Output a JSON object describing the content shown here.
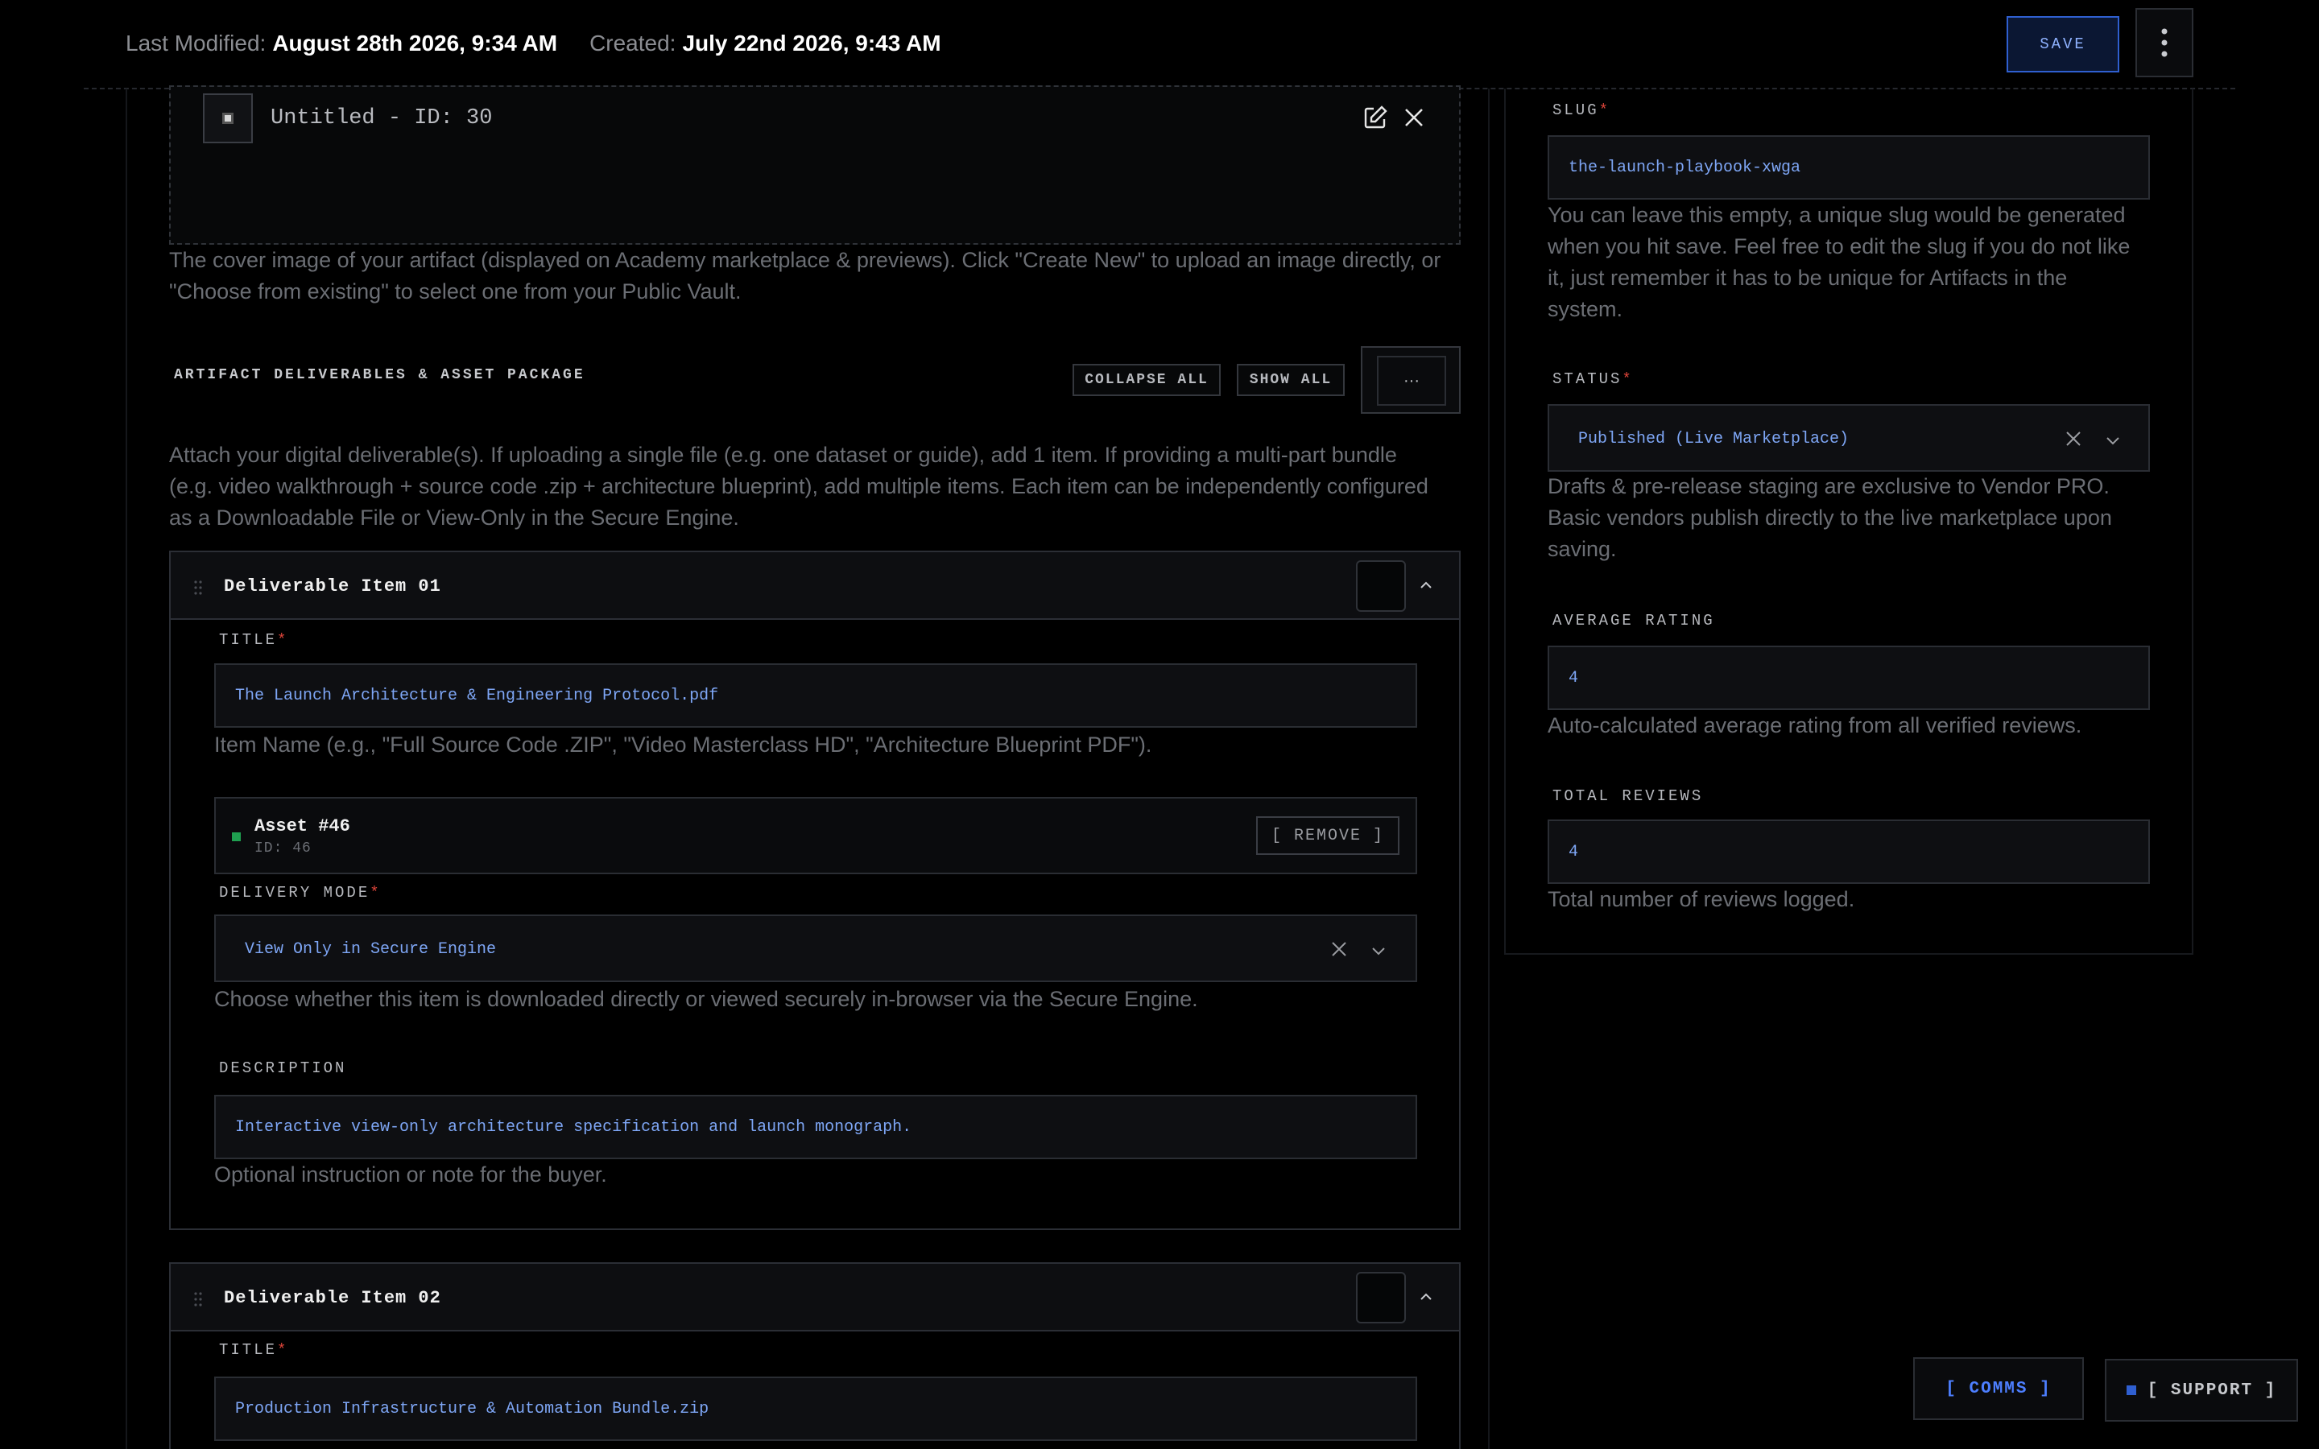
{
  "header": {
    "last_modified_label": "Last Modified:",
    "last_modified_value": "August 28th 2026, 9:34 AM",
    "created_label": "Created:",
    "created_value": "July 22nd 2026, 9:43 AM",
    "save_label": "SAVE",
    "menu_icon": "kebab-vertical-icon"
  },
  "cover": {
    "title": "Untitled - ID: 30",
    "help_line1": "The cover image of your artifact (displayed on Academy marketplace & previews). Click \"Create New\" to upload an image directly, or",
    "help_line2": "\"Choose from existing\" to select one from your Public Vault."
  },
  "deliverables": {
    "section_title": "ARTIFACT DELIVERABLES & ASSET PACKAGE",
    "collapse_all": "COLLAPSE ALL",
    "show_all": "SHOW ALL",
    "more": "···",
    "help_line1": "Attach your digital deliverable(s). If uploading a single file (e.g. one dataset or guide), add 1 item. If providing a multi-part bundle",
    "help_line2": "(e.g. video walkthrough + source code .zip + architecture blueprint), add multiple items. Each item can be independently configured",
    "help_line3": "as a Downloadable File or View-Only in the Secure Engine.",
    "items": [
      {
        "heading": "Deliverable Item 01",
        "title_label": "TITLE",
        "title_value": "The Launch Architecture & Engineering Protocol.pdf",
        "title_help": "Item Name (e.g., \"Full Source Code .ZIP\", \"Video Masterclass HD\", \"Architecture Blueprint PDF\").",
        "asset_name": "Asset #46",
        "asset_id": "ID: 46",
        "remove_label": "[ REMOVE ]",
        "delivery_label": "DELIVERY MODE",
        "delivery_value": "View Only in Secure Engine",
        "delivery_help": "Choose whether this item is downloaded directly or viewed securely in-browser via the Secure Engine.",
        "description_label": "DESCRIPTION",
        "description_value": "Interactive view-only architecture specification and launch monograph.",
        "description_help": "Optional instruction or note for the buyer."
      },
      {
        "heading": "Deliverable Item 02",
        "title_label": "TITLE",
        "title_value": "Production Infrastructure & Automation Bundle.zip"
      }
    ]
  },
  "sidebar": {
    "slug_label": "SLUG",
    "slug_value": "the-launch-playbook-xwga",
    "slug_help_1": "You can leave this empty, a unique slug would be generated",
    "slug_help_2": "when you hit save. Feel free to edit the slug if you do not like",
    "slug_help_3": "it, just remember it has to be unique for Artifacts in the",
    "slug_help_4": "system.",
    "status_label": "STATUS",
    "status_value": "Published (Live Marketplace)",
    "status_help_1": "Drafts & pre-release staging are exclusive to Vendor PRO.",
    "status_help_2": "Basic vendors publish directly to the live marketplace upon",
    "status_help_3": "saving.",
    "rating_label": "AVERAGE RATING",
    "rating_value": "4",
    "rating_help": "Auto-calculated average rating from all verified reviews.",
    "reviews_label": "TOTAL REVIEWS",
    "reviews_value": "4",
    "reviews_help": "Total number of reviews logged."
  },
  "floating": {
    "comms": "[ COMMS ]",
    "support": "[ SUPPORT ]"
  },
  "colors": {
    "accent": "#2f5fd0",
    "value_text": "#7ea6f5",
    "required": "#e0453a",
    "asset_ok": "#1fa050"
  }
}
